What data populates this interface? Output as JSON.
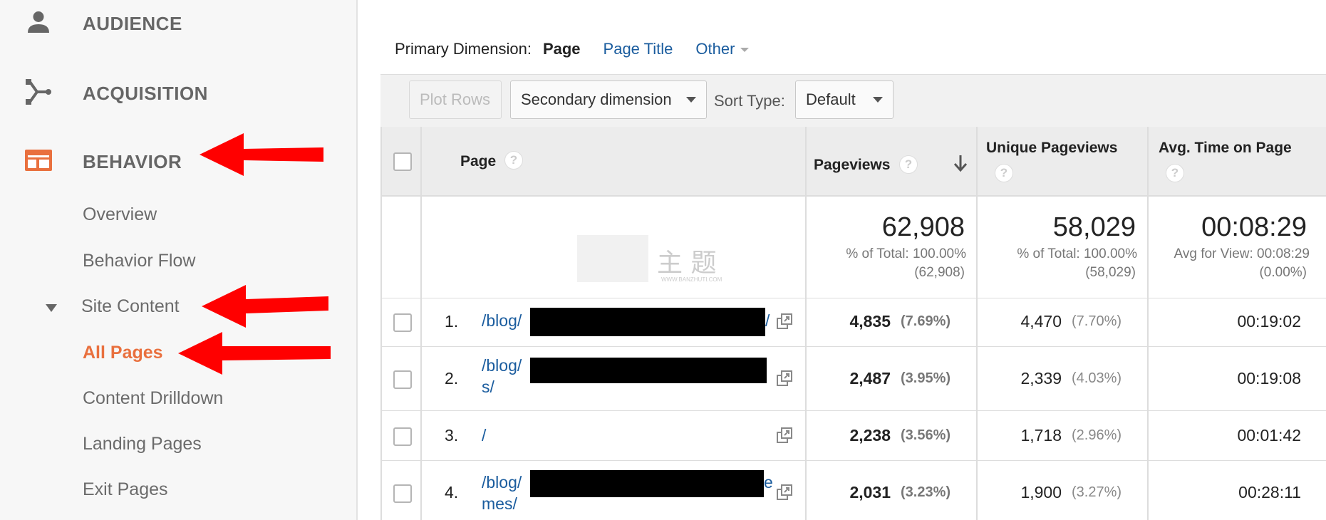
{
  "sidebar": {
    "sections": [
      {
        "label": "AUDIENCE",
        "icon": "person-icon"
      },
      {
        "label": "ACQUISITION",
        "icon": "acquisition-icon"
      },
      {
        "label": "BEHAVIOR",
        "icon": "behavior-icon"
      }
    ],
    "behavior_items": [
      {
        "label": "Overview"
      },
      {
        "label": "Behavior Flow"
      },
      {
        "label": "Site Content"
      },
      {
        "label": "All Pages"
      },
      {
        "label": "Content Drilldown"
      },
      {
        "label": "Landing Pages"
      },
      {
        "label": "Exit Pages"
      }
    ]
  },
  "primary_dimension": {
    "label": "Primary Dimension:",
    "current": "Page",
    "options": [
      "Page Title",
      "Other"
    ]
  },
  "toolbar": {
    "plot_rows": "Plot Rows",
    "secondary_dimension": "Secondary dimension",
    "sort_type_label": "Sort Type:",
    "sort_type_value": "Default"
  },
  "table": {
    "headers": {
      "page": "Page",
      "pageviews": "Pageviews",
      "unique_pageviews": "Unique Pageviews",
      "avg_time": "Avg. Time on Page"
    },
    "totals": {
      "pageviews": "62,908",
      "pageviews_pct": "% of Total: 100.00%",
      "pageviews_sub": "(62,908)",
      "unique": "58,029",
      "unique_pct": "% of Total: 100.00%",
      "unique_sub": "(58,029)",
      "avg_time": "00:08:29",
      "avg_time_line1": "Avg for View: 00:08:29",
      "avg_time_line2": "(0.00%)"
    },
    "rows": [
      {
        "num": "1.",
        "page_a": "/blog/",
        "page_b": "/",
        "pageviews": "4,835",
        "pv_pct": "(7.69%)",
        "unique": "4,470",
        "u_pct": "(7.70%)",
        "time": "00:19:02"
      },
      {
        "num": "2.",
        "page_a": "/blog/",
        "page_b": "s/",
        "pageviews": "2,487",
        "pv_pct": "(3.95%)",
        "unique": "2,339",
        "u_pct": "(4.03%)",
        "time": "00:19:08"
      },
      {
        "num": "3.",
        "page_a": "/",
        "page_b": "",
        "pageviews": "2,238",
        "pv_pct": "(3.56%)",
        "unique": "1,718",
        "u_pct": "(2.96%)",
        "time": "00:01:42"
      },
      {
        "num": "4.",
        "page_a": "/blog/",
        "page_b": "mes/",
        "page_c": "e",
        "pageviews": "2,031",
        "pv_pct": "(3.23%)",
        "unique": "1,900",
        "u_pct": "(3.27%)",
        "time": "00:28:11"
      }
    ]
  },
  "watermark": {
    "text": "主 题",
    "sub": "WWW.BANZHUTI.COM"
  },
  "colors": {
    "accent": "#e9703e",
    "link": "#1a5c9e",
    "arrow": "#ff0000"
  }
}
